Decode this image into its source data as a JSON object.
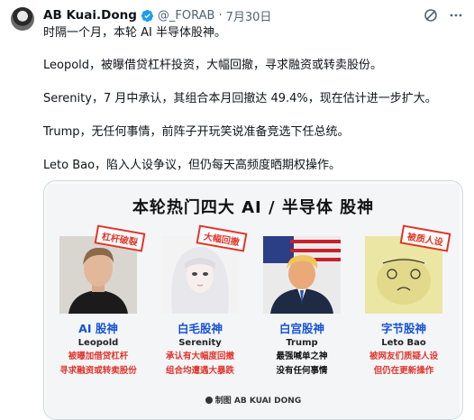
{
  "tweet": {
    "author_name": "AB Kuai.Dong",
    "handle": "@_FORAB",
    "separator": "·",
    "date": "7月30日",
    "paragraphs": [
      "时隔一个月，本轮 AI 半导体股神。",
      "Leopold，被曝借贷杠杆投资，大幅回撤，寻求融资或转卖股份。",
      "Serenity，7 月中承认，其组合本月回撤达 49.4%，现在估计进一步扩大。",
      "Trump，无任何事情，前阵子开玩笑说准备竞选下任总统。",
      "Leto Bao，陷入人设争议，但仍每天高频度晒期权操作。"
    ]
  },
  "icons": {
    "verified": "verified-badge-icon",
    "grok": "grok-icon",
    "more": "more-icon"
  },
  "colors": {
    "accent_blue": "#1d9bf0",
    "card_blue": "#1653d6",
    "stamp_red": "#e0352b"
  },
  "card": {
    "title": "本轮热门四大 AI / 半导体 股神",
    "credit": "制图 AB KUAI DONG",
    "people": [
      {
        "stamp": "杠杆破裂",
        "title": "AI 股神",
        "name": "Leopold",
        "desc": [
          "被曝加借贷杠杆",
          "寻求融资或转卖股份"
        ],
        "desc_style": "red"
      },
      {
        "stamp": "大幅回撤",
        "title": "白毛股神",
        "name": "Serenity",
        "desc": [
          "承认有大幅度回撤",
          "组合均遭遇大暴跌"
        ],
        "desc_style": "red"
      },
      {
        "stamp": "",
        "title": "白宫股神",
        "name": "Trump",
        "desc": [
          "最强喊单之神",
          "没有任何事情"
        ],
        "desc_style": "dark"
      },
      {
        "stamp": "被质人设",
        "title": "字节股神",
        "name": "Leto Bao",
        "desc": [
          "被网友们质疑人设",
          "但仍在更新操作"
        ],
        "desc_style": "red"
      }
    ]
  }
}
